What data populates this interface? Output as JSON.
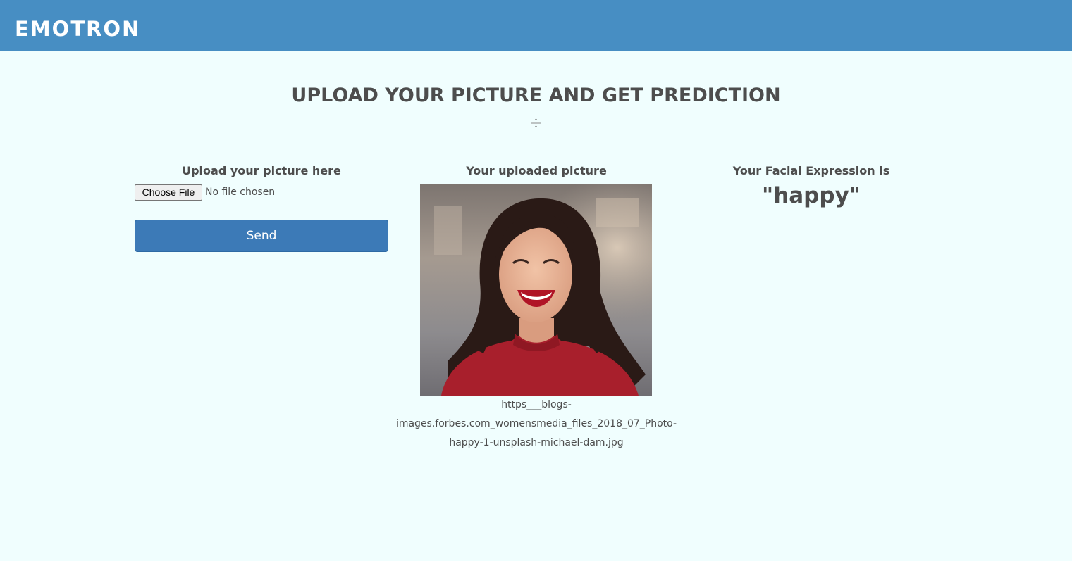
{
  "app": {
    "brand": "EMOTRON"
  },
  "page": {
    "title": "UPLOAD YOUR PICTURE AND GET PREDICTION"
  },
  "upload": {
    "heading": "Upload your picture here",
    "choose_file_label": "Choose File",
    "file_status": "No file chosen",
    "send_label": "Send"
  },
  "preview": {
    "heading": "Your uploaded picture",
    "file_name": "https___blogs-images.forbes.com_womensmedia_files_2018_07_Photo-happy-1-unsplash-michael-dam.jpg",
    "file_name_lines": [
      "https___blogs-",
      "images.forbes.com_womensmedia_files_2018_07_Photo-",
      "happy-1-unsplash-michael-dam.jpg"
    ]
  },
  "result": {
    "heading": "Your Facial Expression is",
    "prediction": "\"happy\""
  },
  "colors": {
    "navbar": "#478ec3",
    "background": "#f0fefe",
    "button": "#3c7ab7",
    "text": "#4d4d4d"
  },
  "icons": {
    "divider": "divide-icon"
  }
}
